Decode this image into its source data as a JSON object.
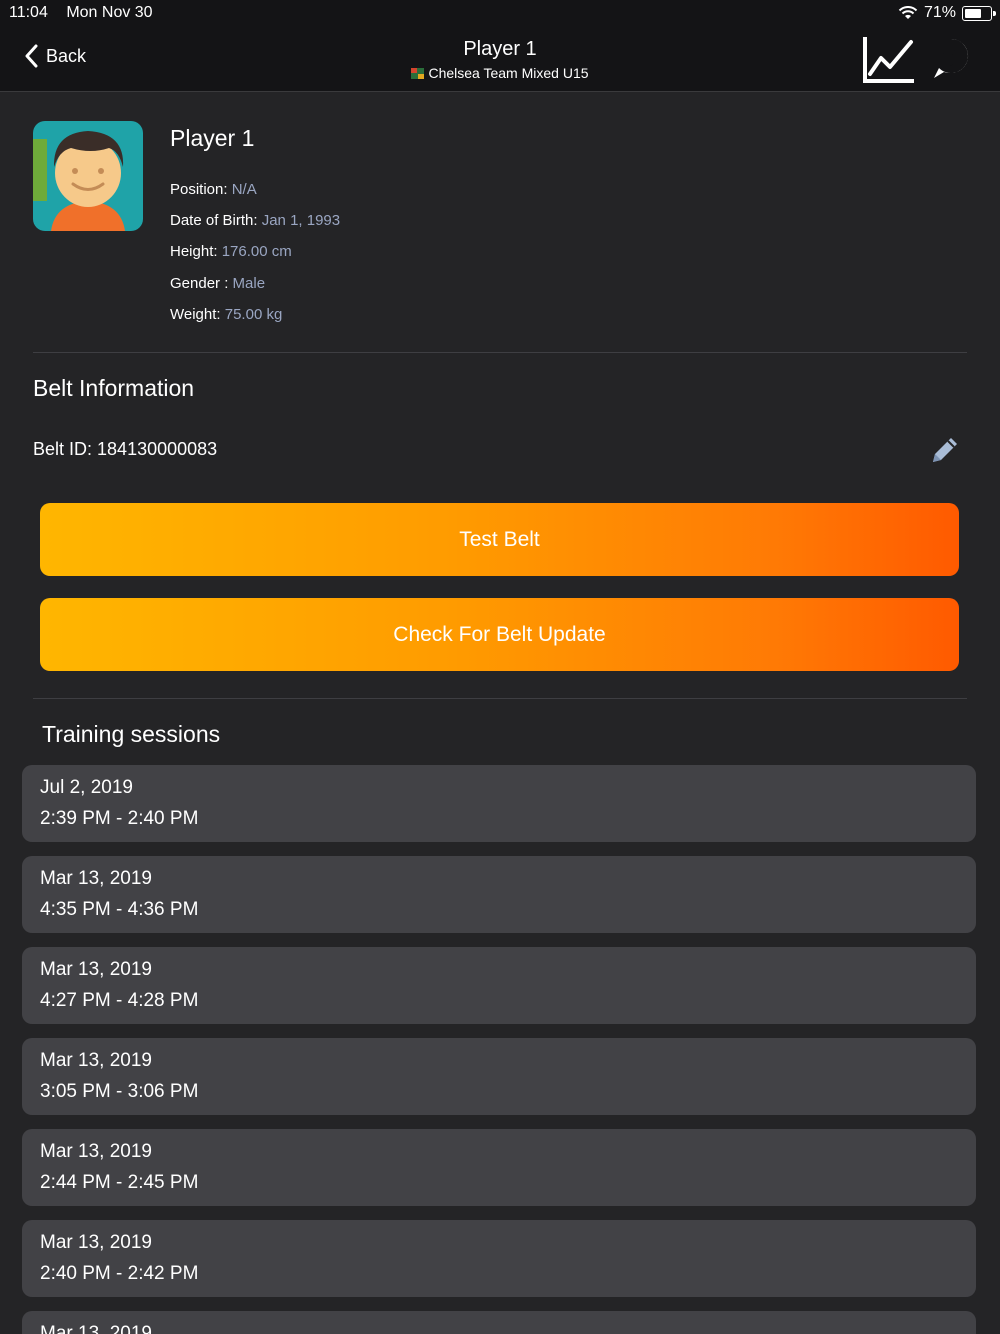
{
  "status_bar": {
    "time": "11:04",
    "date": "Mon Nov 30",
    "battery": "71%",
    "battery_level": 0.71
  },
  "nav": {
    "back_label": "Back",
    "title": "Player 1",
    "team": "Chelsea Team Mixed U15",
    "icons": [
      "back-chevron-icon",
      "stats-chart-icon",
      "help-icon"
    ]
  },
  "player": {
    "name": "Player 1",
    "position_label": "Position: ",
    "position": "N/A",
    "dob_label": "Date of Birth:  ",
    "dob": "Jan 1, 1993",
    "height_label": "Height: ",
    "height": "176.00 cm",
    "gender_label": "Gender : ",
    "gender": "Male",
    "weight_label": "Weight: ",
    "weight": "75.00 kg"
  },
  "belt": {
    "section_title": "Belt Information",
    "belt_id_label": "Belt ID:  ",
    "belt_id": "184130000083",
    "test_button": "Test Belt",
    "update_button": "Check For Belt Update"
  },
  "training": {
    "section_title": "Training sessions",
    "sessions": [
      {
        "date": "Jul 2, 2019",
        "time": "2:39 PM - 2:40 PM"
      },
      {
        "date": "Mar 13, 2019",
        "time": "4:35 PM - 4:36 PM"
      },
      {
        "date": "Mar 13, 2019",
        "time": "4:27 PM - 4:28 PM"
      },
      {
        "date": "Mar 13, 2019",
        "time": "3:05 PM - 3:06 PM"
      },
      {
        "date": "Mar 13, 2019",
        "time": "2:44 PM - 2:45 PM"
      },
      {
        "date": "Mar 13, 2019",
        "time": "2:40 PM - 2:42 PM"
      },
      {
        "date": "Mar 13, 2019",
        "time": ""
      }
    ]
  },
  "colors": {
    "background": "#242426",
    "bar": "#141416",
    "card": "#424246",
    "value_text": "#9aa6c2",
    "gradient_start": "#ffb600",
    "gradient_end": "#ff5a00"
  }
}
